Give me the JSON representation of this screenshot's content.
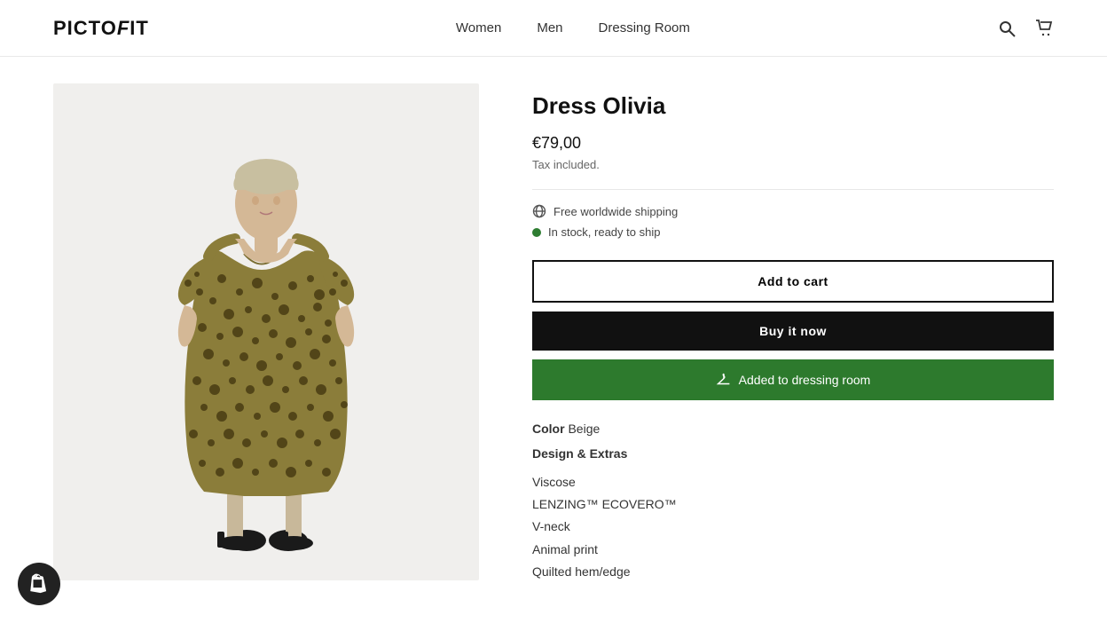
{
  "header": {
    "logo": "PICTOFIT",
    "nav": [
      {
        "label": "Women",
        "href": "#"
      },
      {
        "label": "Men",
        "href": "#"
      },
      {
        "label": "Dressing Room",
        "href": "#"
      }
    ]
  },
  "product": {
    "title": "Dress Olivia",
    "price": "€79,00",
    "tax_note": "Tax included.",
    "shipping": "Free worldwide shipping",
    "stock": "In stock, ready to ship",
    "add_to_cart_label": "Add to cart",
    "buy_now_label": "Buy it now",
    "dressing_room_label": "Added to dressing room",
    "color_label": "Color",
    "color_value": "Beige",
    "design_extras_label": "Design & Extras",
    "features": [
      "Viscose",
      "LENZING™ ECOVERO™",
      "V-neck",
      "Animal print",
      "Quilted hem/edge"
    ]
  }
}
